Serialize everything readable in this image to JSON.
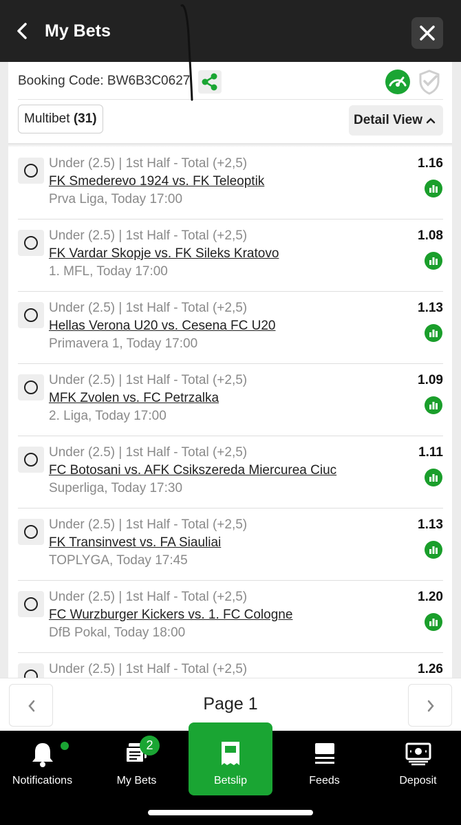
{
  "header": {
    "title": "My Bets"
  },
  "booking": {
    "label": "Booking Code: BW6B3C0627"
  },
  "multibet": {
    "label": "Multibet",
    "count": "(31)"
  },
  "detail_view": {
    "label": "Detail View"
  },
  "bets": [
    {
      "market": "Under (2.5) | 1st Half - Total (+2,5)",
      "match": "FK Smederevo 1924 vs. FK Teleoptik",
      "league": "Prva Liga, Today 17:00",
      "odds": "1.16"
    },
    {
      "market": "Under (2.5) | 1st Half - Total (+2,5)",
      "match": "FK Vardar Skopje vs. FK Sileks Kratovo",
      "league": "1. MFL, Today 17:00",
      "odds": "1.08"
    },
    {
      "market": "Under (2.5) | 1st Half - Total (+2,5)",
      "match": "Hellas Verona U20 vs. Cesena FC U20",
      "league": "Primavera 1, Today 17:00",
      "odds": "1.13"
    },
    {
      "market": "Under (2.5) | 1st Half - Total (+2,5)",
      "match": "MFK Zvolen vs. FC Petrzalka",
      "league": "2. Liga, Today 17:00",
      "odds": "1.09"
    },
    {
      "market": "Under (2.5) | 1st Half - Total (+2,5)",
      "match": "FC Botosani vs. AFK Csikszereda Miercurea Ciuc",
      "league": "Superliga, Today 17:30",
      "odds": "1.11"
    },
    {
      "market": "Under (2.5) | 1st Half - Total (+2,5)",
      "match": "FK Transinvest vs. FA Siauliai",
      "league": "TOPLYGA, Today 17:45",
      "odds": "1.13"
    },
    {
      "market": "Under (2.5) | 1st Half - Total (+2,5)",
      "match": "FC Wurzburger Kickers vs. 1. FC Cologne",
      "league": "DfB Pokal, Today 18:00",
      "odds": "1.20"
    },
    {
      "market": "Under (2.5) | 1st Half - Total (+2,5)",
      "match": "",
      "league": "",
      "odds": "1.26"
    }
  ],
  "pager": {
    "label": "Page 1"
  },
  "nav": {
    "notifications": "Notifications",
    "my_bets": "My Bets",
    "my_bets_badge": "2",
    "betslip": "Betslip",
    "feeds": "Feeds",
    "deposit": "Deposit"
  },
  "colors": {
    "accent": "#1aa533",
    "topbar": "#222222"
  }
}
